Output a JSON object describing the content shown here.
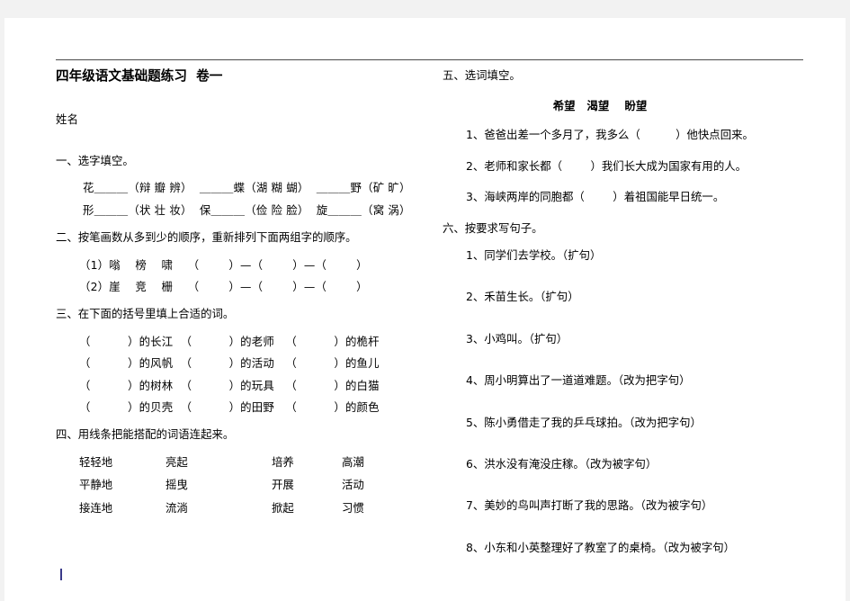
{
  "document": {
    "title": "四年级语文基础题练习  卷一",
    "name_field": "姓名"
  },
  "left_column": {
    "section1": {
      "heading": "一、选字填空。",
      "lines": [
        "花＿＿＿（辩 瓣 辨）  ＿＿＿蝶（湖 糊 蝴）  ＿＿＿野（矿 旷）",
        "形＿＿＿（状 壮 妆）  保＿＿＿（俭 险 脸）  旋＿＿＿（窝 涡）"
      ]
    },
    "section2": {
      "heading": "二、按笔画数从多到少的顺序，重新排列下面两组字的顺序。",
      "lines": [
        "（1）嗡    榜    啸    （        ）—（        ）—（        ）",
        "（2）崖    竞    栅    （        ）—（        ）—（        ）"
      ]
    },
    "section3": {
      "heading": "三、在下面的括号里填上合适的词。",
      "rows": [
        "（          ）的长江  （          ）的老师   （          ）的桅杆",
        "（          ）的风帆  （          ）的活动   （          ）的鱼儿",
        "（          ）的树林  （          ）的玩具   （          ）的白猫",
        "（          ）的贝壳  （          ）的田野   （          ）的颜色"
      ]
    },
    "section4": {
      "heading": "四、用线条把能搭配的词语连起来。",
      "columns": [
        "轻轻地",
        "亮起",
        "培养",
        "高潮"
      ],
      "rows": [
        [
          "轻轻地",
          "亮起",
          "培养",
          "高潮"
        ],
        [
          "平静地",
          "摇曳",
          "开展",
          "活动"
        ],
        [
          "接连地",
          "流淌",
          "掀起",
          "习惯"
        ]
      ]
    }
  },
  "right_column": {
    "section5": {
      "heading": "五、选词填空。",
      "word_bank": "希望   渴望    盼望",
      "items": [
        "1、爸爸出差一个多月了，我多么（          ）他快点回来。",
        "2、老师和家长都（        ）我们长大成为国家有用的人。",
        "3、海峡两岸的同胞都（        ）着祖国能早日统一。"
      ]
    },
    "section6": {
      "heading": "六、按要求写句子。",
      "items": [
        "1、同学们去学校。（扩句）",
        "2、禾苗生长。（扩句）",
        "3、小鸡叫。（扩句）",
        "4、周小明算出了一道道难题。（改为把字句）",
        "5、陈小勇借走了我的乒乓球拍。（改为把字句）",
        "6、洪水没有淹没庄稼。（改为被字句）",
        "7、美妙的鸟叫声打断了我的思路。（改为被字句）",
        "8、小东和小英整理好了教室了的桌椅。（改为被字句）"
      ]
    }
  },
  "colors": {
    "page_background": "#f2f2f2",
    "document_background": "#ffffff",
    "text": "#000000",
    "rule": "#4a4a4a",
    "cursor": "#3a3a8a"
  }
}
